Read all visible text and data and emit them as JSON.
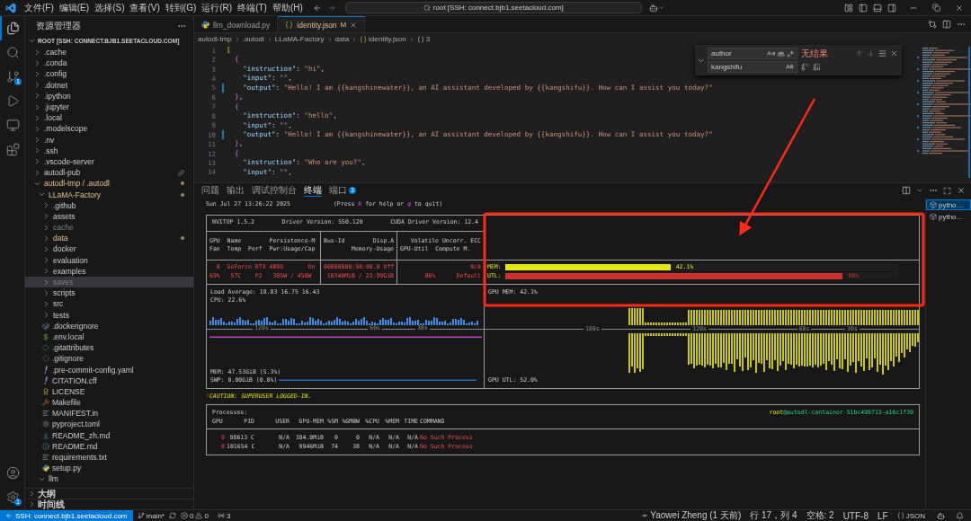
{
  "title_bar": {
    "menu": [
      "文件(F)",
      "编辑(E)",
      "选择(S)",
      "查看(V)",
      "转到(G)",
      "运行(R)",
      "终端(T)",
      "帮助(H)"
    ],
    "command_center": "root [SSH: connect.bjb1.seetacloud.com]"
  },
  "activity_bar": {
    "top": [
      {
        "kind": "explorer",
        "selected": true
      },
      {
        "kind": "search",
        "selected": false
      },
      {
        "kind": "source-control",
        "selected": false,
        "badge": "1"
      },
      {
        "kind": "run",
        "selected": false
      },
      {
        "kind": "remote",
        "selected": false
      },
      {
        "kind": "extensions",
        "selected": false
      }
    ],
    "bottom": [
      {
        "kind": "account"
      },
      {
        "kind": "settings",
        "badge": "1"
      }
    ]
  },
  "sidebar": {
    "title": "资源管理器",
    "root": "ROOT [SSH: CONNECT.BJB1.SEETACLOUD.COM]",
    "tree": [
      {
        "label": ".cache",
        "kind": "folder",
        "expanded": false,
        "modified": false,
        "ignored": false,
        "selected": false
      },
      {
        "label": ".conda",
        "kind": "folder",
        "expanded": false,
        "modified": false,
        "ignored": false,
        "selected": false
      },
      {
        "label": ".config",
        "kind": "folder",
        "expanded": false,
        "modified": false,
        "ignored": false,
        "selected": false
      },
      {
        "label": ".dotnet",
        "kind": "folder",
        "expanded": false,
        "modified": false,
        "ignored": false,
        "selected": false
      },
      {
        "label": ".ipython",
        "kind": "folder",
        "expanded": false,
        "modified": false,
        "ignored": false,
        "selected": false
      },
      {
        "label": ".jupyter",
        "kind": "folder",
        "expanded": false,
        "modified": false,
        "ignored": false,
        "selected": false
      },
      {
        "label": ".local",
        "kind": "folder",
        "expanded": false,
        "modified": false,
        "ignored": false,
        "selected": false
      },
      {
        "label": ".modelscope",
        "kind": "folder",
        "expanded": false,
        "modified": false,
        "ignored": false,
        "selected": false
      },
      {
        "label": ".nv",
        "kind": "folder",
        "expanded": false,
        "modified": false,
        "ignored": false,
        "selected": false
      },
      {
        "label": ".ssh",
        "kind": "folder",
        "expanded": false,
        "modified": false,
        "ignored": false,
        "selected": false
      },
      {
        "label": ".vscode-server",
        "kind": "folder",
        "expanded": false,
        "modified": false,
        "ignored": false,
        "selected": false
      },
      {
        "label": "autodl-pub",
        "kind": "folder",
        "expanded": false,
        "modified": false,
        "ignored": false,
        "selected": false,
        "linked": true
      },
      {
        "label": "autodl-tmp / .autodl",
        "kind": "folder",
        "expanded": true,
        "modified": true,
        "ignored": false,
        "selected": false,
        "children": [
          {
            "label": "LLaMA-Factory",
            "kind": "folder",
            "expanded": true,
            "modified": true,
            "ignored": false,
            "selected": false,
            "children": [
              {
                "label": ".github",
                "kind": "folder",
                "expanded": false,
                "modified": false,
                "ignored": false,
                "selected": false
              },
              {
                "label": "assets",
                "kind": "folder",
                "expanded": false,
                "modified": false,
                "ignored": false,
                "selected": false
              },
              {
                "label": "cache",
                "kind": "folder",
                "expanded": false,
                "modified": false,
                "ignored": true,
                "selected": false
              },
              {
                "label": "data",
                "kind": "folder",
                "expanded": false,
                "modified": true,
                "ignored": false,
                "selected": false
              },
              {
                "label": "docker",
                "kind": "folder",
                "expanded": false,
                "modified": false,
                "ignored": false,
                "selected": false
              },
              {
                "label": "evaluation",
                "kind": "folder",
                "expanded": false,
                "modified": false,
                "ignored": false,
                "selected": false
              },
              {
                "label": "examples",
                "kind": "folder",
                "expanded": false,
                "modified": false,
                "ignored": false,
                "selected": false
              },
              {
                "label": "saves",
                "kind": "folder",
                "expanded": false,
                "modified": false,
                "ignored": true,
                "selected": true
              },
              {
                "label": "scripts",
                "kind": "folder",
                "expanded": false,
                "modified": false,
                "ignored": false,
                "selected": false
              },
              {
                "label": "src",
                "kind": "folder",
                "expanded": false,
                "modified": false,
                "ignored": false,
                "selected": false
              },
              {
                "label": "tests",
                "kind": "folder",
                "expanded": false,
                "modified": false,
                "ignored": false,
                "selected": false
              },
              {
                "label": ".dockerignore",
                "kind": "docker",
                "modified": false,
                "ignored": false,
                "selected": false
              },
              {
                "label": ".env.local",
                "kind": "env",
                "modified": false,
                "ignored": false,
                "selected": false
              },
              {
                "label": ".gitattributes",
                "kind": "git",
                "modified": false,
                "ignored": false,
                "selected": false
              },
              {
                "label": ".gitignore",
                "kind": "git",
                "modified": false,
                "ignored": false,
                "selected": false
              },
              {
                "label": ".pre-commit-config.yaml",
                "kind": "yaml",
                "modified": false,
                "ignored": false,
                "selected": false
              },
              {
                "label": "CITATION.cff",
                "kind": "yaml",
                "modified": false,
                "ignored": false,
                "selected": false
              },
              {
                "label": "LICENSE",
                "kind": "license",
                "modified": false,
                "ignored": false,
                "selected": false
              },
              {
                "label": "Makefile",
                "kind": "makefile",
                "modified": false,
                "ignored": false,
                "selected": false
              },
              {
                "label": "MANIFEST.in",
                "kind": "text",
                "modified": false,
                "ignored": false,
                "selected": false
              },
              {
                "label": "pyproject.toml",
                "kind": "config",
                "modified": false,
                "ignored": false,
                "selected": false
              },
              {
                "label": "README_zh.md",
                "kind": "markdown",
                "modified": false,
                "ignored": false,
                "selected": false
              },
              {
                "label": "README.md",
                "kind": "readme",
                "modified": false,
                "ignored": false,
                "selected": false
              },
              {
                "label": "requirements.txt",
                "kind": "text",
                "modified": false,
                "ignored": false,
                "selected": false
              },
              {
                "label": "setup.py",
                "kind": "python",
                "modified": false,
                "ignored": false,
                "selected": false
              }
            ]
          },
          {
            "label": "llm",
            "kind": "folder",
            "expanded": true,
            "modified": false,
            "ignored": false,
            "selected": false
          }
        ]
      }
    ],
    "sections": [
      {
        "label": "大纲",
        "expanded": false
      },
      {
        "label": "时间线",
        "expanded": false
      }
    ]
  },
  "editor": {
    "tabs": [
      {
        "label": "llm_download.py",
        "kind": "python",
        "selected": false
      },
      {
        "label": "identity.json",
        "kind": "json",
        "selected": true,
        "badge": "M"
      }
    ],
    "breadcrumb": [
      {
        "label": "autodl-tmp",
        "kind": "folder"
      },
      {
        "label": ".autodl",
        "kind": "folder"
      },
      {
        "label": "LLaMA-Factory",
        "kind": "folder"
      },
      {
        "label": "data",
        "kind": "folder"
      },
      {
        "label": "identity.json",
        "kind": "json"
      },
      {
        "label": "3",
        "kind": "object"
      }
    ],
    "lines": [
      {
        "number": "1",
        "changed": false,
        "tokens": [
          {
            "kind": "bracket",
            "text": "["
          }
        ]
      },
      {
        "number": "2",
        "changed": false,
        "tokens": [
          {
            "kind": "brace",
            "text": "  {"
          }
        ]
      },
      {
        "number": "3",
        "changed": false,
        "tokens": [
          {
            "kind": "key",
            "text": "    \"instruction\""
          },
          {
            "kind": "plain",
            "text": ": "
          },
          {
            "kind": "string",
            "text": "\"hi\""
          },
          {
            "kind": "plain",
            "text": ","
          }
        ]
      },
      {
        "number": "4",
        "changed": false,
        "tokens": [
          {
            "kind": "key",
            "text": "    \"input\""
          },
          {
            "kind": "plain",
            "text": ": "
          },
          {
            "kind": "string",
            "text": "\"\""
          },
          {
            "kind": "plain",
            "text": ","
          }
        ]
      },
      {
        "number": "5",
        "changed": true,
        "tokens": [
          {
            "kind": "key",
            "text": "    \"output\""
          },
          {
            "kind": "plain",
            "text": ": "
          },
          {
            "kind": "string",
            "text": "\"Hello! I am {{kangshinewater}}, an AI assistant developed by {{kangshifu}}. How can I assist you today?\""
          }
        ]
      },
      {
        "number": "6",
        "changed": false,
        "tokens": [
          {
            "kind": "brace",
            "text": "  }"
          },
          {
            "kind": "plain",
            "text": ","
          }
        ]
      },
      {
        "number": "7",
        "changed": false,
        "tokens": [
          {
            "kind": "brace",
            "text": "  {"
          }
        ]
      },
      {
        "number": "8",
        "changed": false,
        "tokens": [
          {
            "kind": "key",
            "text": "    \"instruction\""
          },
          {
            "kind": "plain",
            "text": ": "
          },
          {
            "kind": "string",
            "text": "\"hello\""
          },
          {
            "kind": "plain",
            "text": ","
          }
        ]
      },
      {
        "number": "9",
        "changed": false,
        "tokens": [
          {
            "kind": "key",
            "text": "    \"input\""
          },
          {
            "kind": "plain",
            "text": ": "
          },
          {
            "kind": "string",
            "text": "\"\""
          },
          {
            "kind": "plain",
            "text": ","
          }
        ]
      },
      {
        "number": "10",
        "changed": true,
        "tokens": [
          {
            "kind": "key",
            "text": "    \"output\""
          },
          {
            "kind": "plain",
            "text": ": "
          },
          {
            "kind": "string",
            "text": "\"Hello! I am {{kangshinewater}}, an AI assistant developed by {{kangshifu}}. How can I assist you today?\""
          }
        ]
      },
      {
        "number": "11",
        "changed": false,
        "tokens": [
          {
            "kind": "brace",
            "text": "  }"
          },
          {
            "kind": "plain",
            "text": ","
          }
        ]
      },
      {
        "number": "12",
        "changed": false,
        "tokens": [
          {
            "kind": "brace",
            "text": "  {"
          }
        ]
      },
      {
        "number": "13",
        "changed": false,
        "tokens": [
          {
            "kind": "key",
            "text": "    \"instruction\""
          },
          {
            "kind": "plain",
            "text": ": "
          },
          {
            "kind": "string",
            "text": "\"Who are you?\""
          },
          {
            "kind": "plain",
            "text": ","
          }
        ]
      },
      {
        "number": "14",
        "changed": false,
        "tokens": [
          {
            "kind": "key",
            "text": "    \"input\""
          },
          {
            "kind": "plain",
            "text": ": "
          },
          {
            "kind": "string",
            "text": "\"\""
          },
          {
            "kind": "plain",
            "text": ","
          }
        ]
      }
    ],
    "find": {
      "query": "author",
      "result": "无结果",
      "replace": "kangshifu"
    }
  },
  "panel": {
    "tabs": [
      {
        "label": "问题",
        "selected": false
      },
      {
        "label": "输出",
        "selected": false
      },
      {
        "label": "调试控制台",
        "selected": false
      },
      {
        "label": "终端",
        "selected": true
      },
      {
        "label": "端口",
        "selected": false,
        "badge": "3"
      }
    ],
    "terminal": {
      "timestamp": "Sun Jul 27 13:26:22 2025",
      "help": [
        {
          "kind": "plain",
          "text": "(Press "
        },
        {
          "kind": "key",
          "text": "h"
        },
        {
          "kind": "plain",
          "text": " for help or "
        },
        {
          "kind": "key",
          "text": "q"
        },
        {
          "kind": "plain",
          "text": " to quit)"
        }
      ],
      "version": "NVITOP 1.5.2",
      "driver": "Driver Version: 550.120",
      "cuda": "CUDA Driver Version: 12.4",
      "header_1": [
        "GPU  Name        Persistence-M",
        "Bus-Id        Disp.A",
        "Volatile Uncorr. ECC"
      ],
      "header_2": [
        "Fan  Temp  Perf  Pwr:Usage/Cap",
        "Memory-Usage",
        "GPU-Util  Compute M."
      ],
      "gpu_1": [
        "  0  GeForce RTX 4090       On",
        "00000000:98:00.0 Off",
        "N/A"
      ],
      "gpu_2": [
        "69%   57C    P2   305W / 450W",
        "10340MiB / 23.99GiB",
        "86%      Default"
      ],
      "meters": [
        {
          "label": "MEM:",
          "level": 0.421,
          "reading": "42.1%",
          "color": "#e5e510"
        },
        {
          "label": "UTL:",
          "level": 0.86,
          "reading": "86%",
          "color": "#cd3131"
        }
      ],
      "load_average": "Load Average: 18.83 16.75 16.43",
      "cpu": "CPU: 22.6%",
      "gpu_mem": "GPU MEM: 42.1%",
      "cpu_axis": [
        "120s",
        "60s",
        "30s"
      ],
      "gpu_axis": [
        "180s",
        "120s",
        "60s",
        "30s"
      ],
      "mem": "MEM: 47.53GiB (5.3%)",
      "swap": "SWP: 0.00GiB (0.0%)",
      "gpu_util": "GPU UTL: 52.0%",
      "caution": {
        "mark": "!",
        "message": "CAUTION: SUPERUSER LOGGED-IN."
      },
      "processes": {
        "title": "Processes:",
        "user": "root",
        "host": "@autodl-container-51bc499713-a16c1f39",
        "columns": [
          "GPU",
          "PID",
          "USER",
          "GPU-MEM",
          "%SM",
          "%GMBW",
          "%CPU",
          "%MEM",
          "TIME",
          "COMMAND"
        ],
        "rows": [
          [
            "0",
            "98613 C",
            "N/A",
            "384.0MiB",
            "0",
            "0",
            "N/A",
            "N/A",
            "N/A",
            "No Such Process"
          ],
          [
            "0",
            "101654 C",
            "N/A",
            "9946MiB",
            "74",
            "38",
            "N/A",
            "N/A",
            "N/A",
            "No Such Process"
          ]
        ]
      }
    },
    "terminals": [
      {
        "label": "pytho…",
        "selected": true
      },
      {
        "label": "pytho…",
        "selected": false
      }
    ]
  },
  "status_bar": {
    "remote": "SSH: connect.bjb1.seetacloud.com",
    "branch": "main*",
    "errors": "0",
    "warnings": "0",
    "ports": "3",
    "right": [
      {
        "kind": "blame",
        "text": "Yaowei Zheng (1 天前)"
      },
      {
        "kind": "text",
        "text": "行 17，列 4"
      },
      {
        "kind": "text",
        "text": "空格: 2"
      },
      {
        "kind": "text",
        "text": "UTF-8"
      },
      {
        "kind": "text",
        "text": "LF"
      },
      {
        "kind": "language",
        "text": "JSON"
      }
    ]
  }
}
